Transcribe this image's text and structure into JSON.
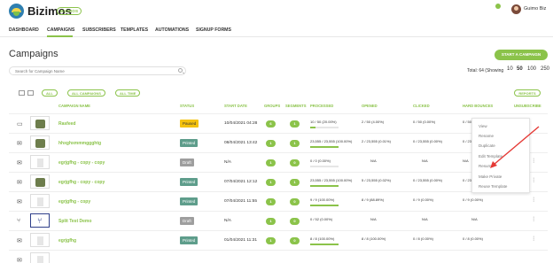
{
  "app": {
    "brand": "Bizimos",
    "badge": "BIZIMOS",
    "username": "Guimo Biz"
  },
  "nav": {
    "items": [
      "DASHBOARD",
      "CAMPAIGNS",
      "SUBSCRIBERS",
      "TEMPLATES",
      "AUTOMATIONS",
      "SIGNUP FORMS"
    ],
    "active": "CAMPAIGNS"
  },
  "page": {
    "title": "Campaigns",
    "start_button": "START A CAMPAIGN",
    "search_placeholder": "Search for Campaign Name",
    "total_label": "Total: 64 (Showing",
    "page_sizes": [
      "10",
      "50",
      "100",
      "250"
    ],
    "active_page_size": "50"
  },
  "filters": {
    "all": "ALL",
    "all_campaigns": "ALL CAMPAIGNS",
    "all_time": "ALL TIME",
    "reports": "REPORTS"
  },
  "table": {
    "headers": [
      "CAMPAIGN NAME",
      "STATUS",
      "START DATE",
      "GROUPS",
      "SEGMENTS",
      "PROCESSED",
      "OPENED",
      "CLICKED",
      "HARD BOUNCES",
      "UNSUBSCRIBE"
    ],
    "rows": [
      {
        "icon": "desktop-icon",
        "thumb": "dark",
        "name": "Rasfeed",
        "status": "Paused",
        "status_type": "paused",
        "date": "10/04/2021 04:28",
        "groups": "6",
        "segments": "1",
        "processed": "10 / 50 (20.00%)",
        "processed_pct": 20,
        "opened": "2 / 50 (4.00%)",
        "clicked": "0 / 50 (0.00%)",
        "bounces": "0 / 50 (0.00%)"
      },
      {
        "icon": "mail-icon",
        "thumb": "dark",
        "name": "hhxghxmmmggghtg",
        "status": "Printed",
        "status_type": "printed",
        "date": "08/04/2021 13:42",
        "groups": "1",
        "segments": "1",
        "processed": "23,555 / 23,555 (100.00%)",
        "processed_pct": 100,
        "opened": "2 / 23,555 (0.01%)",
        "clicked": "0 / 23,555 (0.00%)",
        "bounces": "0 / 23,555 (0.00%)"
      },
      {
        "icon": "mail-icon",
        "thumb": "light",
        "name": "egrjgfhg - copy - copy",
        "status": "Draft",
        "status_type": "draft",
        "date": "N/A",
        "groups": "1",
        "segments": "0",
        "processed": "0 / 0 (0.00%)",
        "processed_pct": 0,
        "opened": "N/A",
        "clicked": "N/A",
        "bounces": "N/A"
      },
      {
        "icon": "mail-icon",
        "thumb": "dark",
        "name": "egrjgfhg - copy - copy",
        "status": "Printed",
        "status_type": "printed",
        "date": "07/04/2021 12:12",
        "groups": "1",
        "segments": "1",
        "processed": "23,555 / 23,555 (100.00%)",
        "processed_pct": 100,
        "opened": "5 / 23,555 (0.02%)",
        "clicked": "0 / 23,555 (0.00%)",
        "bounces": "0 / 23,555 (0.00%)"
      },
      {
        "icon": "mail-icon",
        "thumb": "light",
        "name": "egrjgfhg - copy",
        "status": "Printed",
        "status_type": "printed",
        "date": "07/04/2021 11:55",
        "groups": "1",
        "segments": "0",
        "processed": "9 / 9 (100.00%)",
        "processed_pct": 100,
        "opened": "8 / 9 (88.89%)",
        "clicked": "0 / 9 (0.00%)",
        "bounces": "0 / 9 (0.00%)"
      },
      {
        "icon": "split-icon",
        "thumb": "split",
        "name": "Split Test Demo",
        "status": "Draft",
        "status_type": "draft",
        "date": "N/A",
        "groups": "1",
        "segments": "0",
        "processed": "0 / 52 (0.00%)",
        "processed_pct": 0,
        "opened": "N/A",
        "clicked": "N/A",
        "bounces": "N/A"
      },
      {
        "icon": "mail-icon",
        "thumb": "light",
        "name": "egrjgfhg",
        "status": "Printed",
        "status_type": "printed",
        "date": "01/04/2021 11:31",
        "groups": "1",
        "segments": "0",
        "processed": "8 / 8 (100.00%)",
        "processed_pct": 100,
        "opened": "8 / 8 (100.00%)",
        "clicked": "0 / 8 (0.00%)",
        "bounces": "0 / 8 (0.00%)"
      }
    ]
  },
  "context_menu": {
    "items": [
      "View",
      "Rename",
      "Duplicate",
      "Edit Template",
      "Resume",
      "Make Private",
      "Reuse Template"
    ]
  },
  "colors": {
    "accent": "#8bc34a",
    "paused": "#f4c20d",
    "printed": "#5e9d8b",
    "draft": "#9e9e9e",
    "annotation_arrow": "#e53935"
  }
}
